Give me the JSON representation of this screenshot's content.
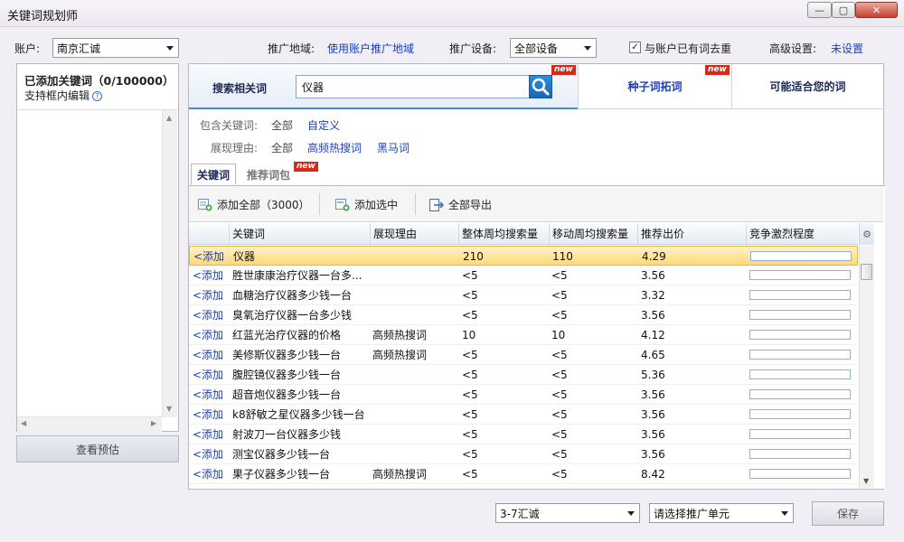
{
  "window": {
    "title": "关键词规划师",
    "controls": {
      "minimize": "—",
      "maximize": "▢",
      "close": "✕"
    }
  },
  "topbar": {
    "account_label": "账户:",
    "account_value": "南京汇诚",
    "region_label": "推广地域:",
    "region_value": "使用账户推广地域",
    "device_label": "推广设备:",
    "device_value": "全部设备",
    "dedupe_checked": true,
    "dedupe_label": "与账户已有词去重",
    "advanced_label": "高级设置:",
    "advanced_value": "未设置"
  },
  "left_panel": {
    "title": "已添加关键词（0/100000）",
    "subtitle": "支持框内编辑",
    "help_icon": "?",
    "preview_button": "查看预估"
  },
  "tabs": {
    "search_label": "搜索相关词",
    "search_value": "仪器",
    "seed_label": "种子词拓词",
    "suitable_label": "可能适合您的词",
    "new_badge": "new"
  },
  "filters": {
    "include_label": "包含关键词:",
    "include_all": "全部",
    "include_custom": "自定义",
    "reason_label": "展现理由:",
    "reason_all": "全部",
    "reason_hot": "高频热搜词",
    "reason_darkhorse": "黑马词"
  },
  "subtabs": {
    "keywords": "关键词",
    "packages": "推荐词包"
  },
  "toolbar": {
    "add_all": "添加全部（3000）",
    "add_selected": "添加选中",
    "export_all": "全部导出"
  },
  "table": {
    "columns": [
      "关键词",
      "展现理由",
      "整体周均搜索量",
      "移动周均搜索量",
      "推荐出价",
      "竞争激烈程度"
    ],
    "add_text": "<添加",
    "rows": [
      {
        "kw": "仪器",
        "reason": "",
        "total": "210",
        "mobile": "110",
        "bid": "4.29",
        "comp": 0.0
      },
      {
        "kw": "胜世康康治疗仪器一台多...",
        "reason": "",
        "total": "<5",
        "mobile": "<5",
        "bid": "3.56",
        "comp": 0.0
      },
      {
        "kw": "血糖治疗仪器多少钱一台",
        "reason": "",
        "total": "<5",
        "mobile": "<5",
        "bid": "3.32",
        "comp": 0.0
      },
      {
        "kw": "臭氧治疗仪器一台多少钱",
        "reason": "",
        "total": "<5",
        "mobile": "<5",
        "bid": "3.56",
        "comp": 0.0
      },
      {
        "kw": "红蓝光治疗仪器的价格",
        "reason": "高频热搜词",
        "total": "10",
        "mobile": "10",
        "bid": "4.12",
        "comp": 0.0
      },
      {
        "kw": "美修斯仪器多少钱一台",
        "reason": "高频热搜词",
        "total": "<5",
        "mobile": "<5",
        "bid": "4.65",
        "comp": 0.0
      },
      {
        "kw": "腹腔镜仪器多少钱一台",
        "reason": "",
        "total": "<5",
        "mobile": "<5",
        "bid": "5.36",
        "comp": 0.0
      },
      {
        "kw": "超音炮仪器多少钱一台",
        "reason": "",
        "total": "<5",
        "mobile": "<5",
        "bid": "3.56",
        "comp": 0.0
      },
      {
        "kw": "k8舒敏之星仪器多少钱一台",
        "reason": "",
        "total": "<5",
        "mobile": "<5",
        "bid": "3.56",
        "comp": 0.0
      },
      {
        "kw": "射波刀一台仪器多少钱",
        "reason": "",
        "total": "<5",
        "mobile": "<5",
        "bid": "3.56",
        "comp": 0.0
      },
      {
        "kw": "测宝仪器多少钱一台",
        "reason": "",
        "total": "<5",
        "mobile": "<5",
        "bid": "3.56",
        "comp": 0.0
      },
      {
        "kw": "果子仪器多少钱一台",
        "reason": "高频热搜词",
        "total": "<5",
        "mobile": "<5",
        "bid": "8.42",
        "comp": 0.0
      }
    ]
  },
  "bottom": {
    "plan_value": "3-7汇诚",
    "unit_value": "请选择推广单元",
    "save_button": "保存"
  }
}
